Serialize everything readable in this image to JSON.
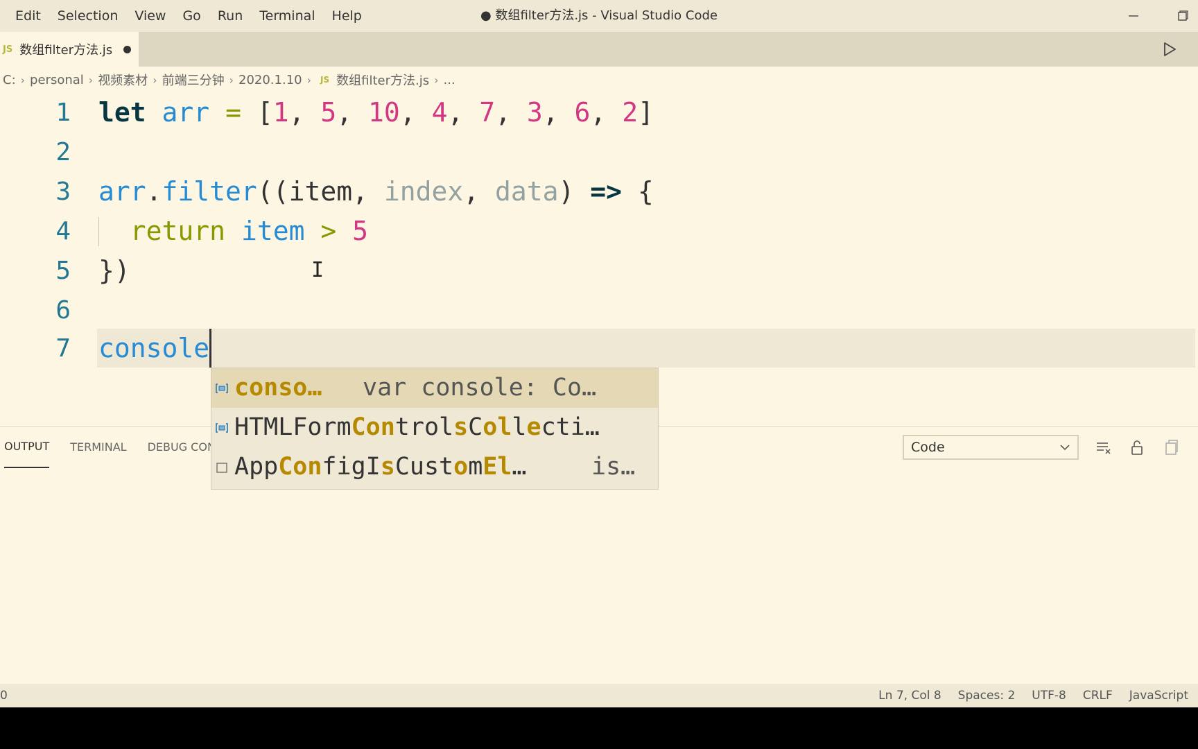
{
  "menu": [
    "Edit",
    "Selection",
    "View",
    "Go",
    "Run",
    "Terminal",
    "Help"
  ],
  "window_title": "● 数组filter方法.js - Visual Studio Code",
  "tab": {
    "badge": "JS",
    "label": "数组filter方法.js"
  },
  "breadcrumb": {
    "items": [
      "C:",
      "personal",
      "视频素材",
      "前端三分钟",
      "2020.1.10"
    ],
    "file_badge": "JS",
    "file": "数组filter方法.js",
    "tail": "..."
  },
  "editor": {
    "line_numbers": [
      "1",
      "2",
      "3",
      "4",
      "5",
      "6",
      "7"
    ],
    "line7_text": "console",
    "cursor": {
      "line": 7,
      "col": 8
    }
  },
  "suggest": {
    "items": [
      {
        "icon": "variable-icon",
        "parts": [
          [
            "conso…",
            true
          ]
        ],
        "detail": "var console: Co…"
      },
      {
        "icon": "variable-icon",
        "parts": [
          [
            "HTMLForm",
            false
          ],
          [
            "Con",
            true
          ],
          [
            "trol",
            false
          ],
          [
            "s",
            true
          ],
          [
            "C",
            false
          ],
          [
            "o",
            true
          ],
          [
            "l",
            true
          ],
          [
            "l",
            false
          ],
          [
            "e",
            true
          ],
          [
            "cti…",
            false
          ]
        ],
        "detail": ""
      },
      {
        "icon": "property-icon",
        "parts": [
          [
            "App",
            false
          ],
          [
            "Con",
            true
          ],
          [
            "figI",
            false
          ],
          [
            "s",
            true
          ],
          [
            "Cust",
            false
          ],
          [
            "o",
            true
          ],
          [
            "m",
            false
          ],
          [
            "El",
            true
          ],
          [
            "…",
            false
          ]
        ],
        "detail": "is…"
      }
    ]
  },
  "panel": {
    "tabs": [
      "OUTPUT",
      "TERMINAL",
      "DEBUG CONS"
    ],
    "active_tab": "OUTPUT",
    "output_channel": "Code"
  },
  "status": {
    "left": "0",
    "position": "Ln 7, Col 8",
    "spaces": "Spaces: 2",
    "encoding": "UTF-8",
    "eol": "CRLF",
    "language": "JavaScript"
  }
}
